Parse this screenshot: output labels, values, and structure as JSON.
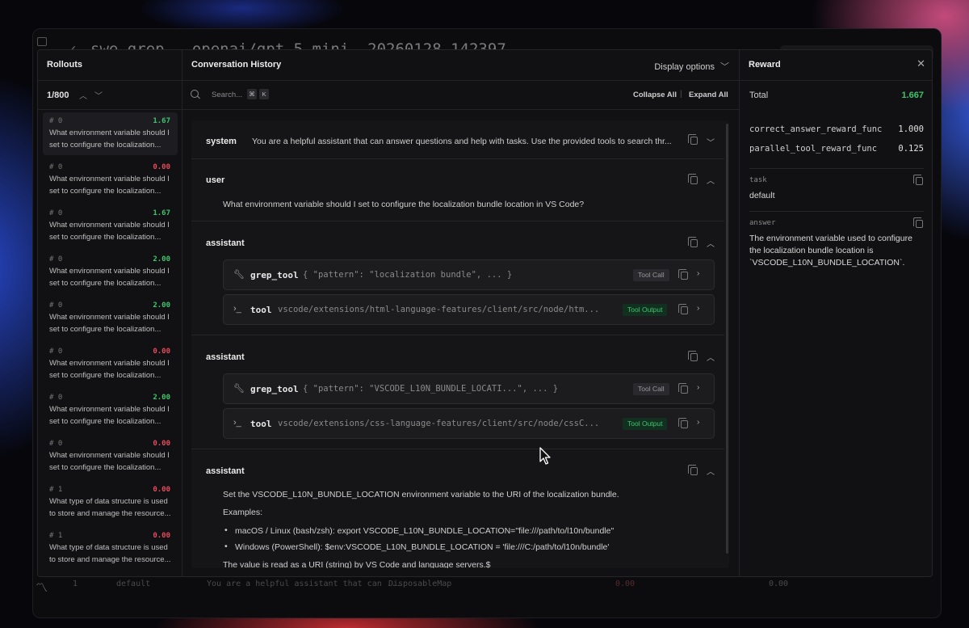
{
  "background": {
    "title": "swe-grep - openai/gpt-5-mini- 20260128-142397",
    "row": [
      "1",
      "default",
      "You are a helpful assistant that can ...",
      "DisposableMap",
      "0.00",
      "0.00"
    ]
  },
  "rollouts": {
    "title": "Rollouts",
    "counter": "1/800",
    "items": [
      {
        "index": "# 0",
        "reward": "1.67",
        "reward_color": "green",
        "question": "What environment variable should I set to configure the localization..."
      },
      {
        "index": "# 0",
        "reward": "0.00",
        "reward_color": "red",
        "question": "What environment variable should I set to configure the localization..."
      },
      {
        "index": "# 0",
        "reward": "1.67",
        "reward_color": "green",
        "question": "What environment variable should I set to configure the localization..."
      },
      {
        "index": "# 0",
        "reward": "2.00",
        "reward_color": "green",
        "question": "What environment variable should I set to configure the localization..."
      },
      {
        "index": "# 0",
        "reward": "2.00",
        "reward_color": "green",
        "question": "What environment variable should I set to configure the localization..."
      },
      {
        "index": "# 0",
        "reward": "0.00",
        "reward_color": "red",
        "question": "What environment variable should I set to configure the localization..."
      },
      {
        "index": "# 0",
        "reward": "2.00",
        "reward_color": "green",
        "question": "What environment variable should I set to configure the localization..."
      },
      {
        "index": "# 0",
        "reward": "0.00",
        "reward_color": "red",
        "question": "What environment variable should I set to configure the localization..."
      },
      {
        "index": "# 1",
        "reward": "0.00",
        "reward_color": "red",
        "question": "What type of data structure is used to store and manage the resource..."
      },
      {
        "index": "# 1",
        "reward": "0.00",
        "reward_color": "red",
        "question": "What type of data structure is used to store and manage the resource..."
      }
    ]
  },
  "conversation": {
    "title": "Conversation History",
    "display_options": "Display options",
    "search_placeholder": "Search...",
    "shortcut": [
      "⌘",
      "K"
    ],
    "collapse_all": "Collapse All",
    "separator": "|",
    "expand_all": "Expand All",
    "messages": {
      "system": {
        "role": "system",
        "text": "You are a helpful assistant that can answer questions and help with tasks. Use the provided tools to search thr..."
      },
      "user": {
        "role": "user",
        "text": "What environment variable should I set to configure the localization bundle location in VS Code?"
      },
      "assistant1": {
        "role": "assistant",
        "call": {
          "name": "grep_tool",
          "args": "{ \"pattern\": \"localization bundle\", ... }",
          "badge": "Tool Call"
        },
        "output": {
          "name": "tool",
          "text": "vscode/extensions/html-language-features/client/src/node/htm...",
          "badge": "Tool Output"
        }
      },
      "assistant2": {
        "role": "assistant",
        "call": {
          "name": "grep_tool",
          "args": "{ \"pattern\": \"VSCODE_L10N_BUNDLE_LOCATI...\", ... }",
          "badge": "Tool Call"
        },
        "output": {
          "name": "tool",
          "text": "vscode/extensions/css-language-features/client/src/node/cssC...",
          "badge": "Tool Output"
        }
      },
      "assistant3": {
        "role": "assistant",
        "line1": "Set the VSCODE_L10N_BUNDLE_LOCATION environment variable to the URI of the localization bundle.",
        "examples_label": "Examples:",
        "bullet1": "macOS / Linux (bash/zsh): export VSCODE_L10N_BUNDLE_LOCATION=\"file:///path/to/l10n/bundle\"",
        "bullet2": "Windows (PowerShell): $env:VSCODE_L10N_BUNDLE_LOCATION = 'file:///C:/path/to/l10n/bundle'",
        "line_last": "The value is read as a URI (string) by VS Code and language servers.$"
      }
    }
  },
  "reward": {
    "title": "Reward",
    "total_label": "Total",
    "total_value": "1.667",
    "funcs": [
      {
        "name": "correct_answer_reward_func",
        "value": "1.000"
      },
      {
        "name": "parallel_tool_reward_func",
        "value": "0.125"
      }
    ],
    "task_label": "task",
    "task_value": "default",
    "answer_label": "answer",
    "answer_value": "The environment variable used to configure the localization bundle location is `VSCODE_L10N_BUNDLE_LOCATION`."
  },
  "colors": {
    "green": "#3ec46d",
    "red": "#e64a5c"
  },
  "icons": [
    "sidebar-icon",
    "search-icon",
    "copy-icon",
    "chevron-down-icon",
    "chevron-up-icon",
    "chevron-right-icon",
    "wrench-icon",
    "terminal-icon",
    "close-icon",
    "logo-icon"
  ]
}
